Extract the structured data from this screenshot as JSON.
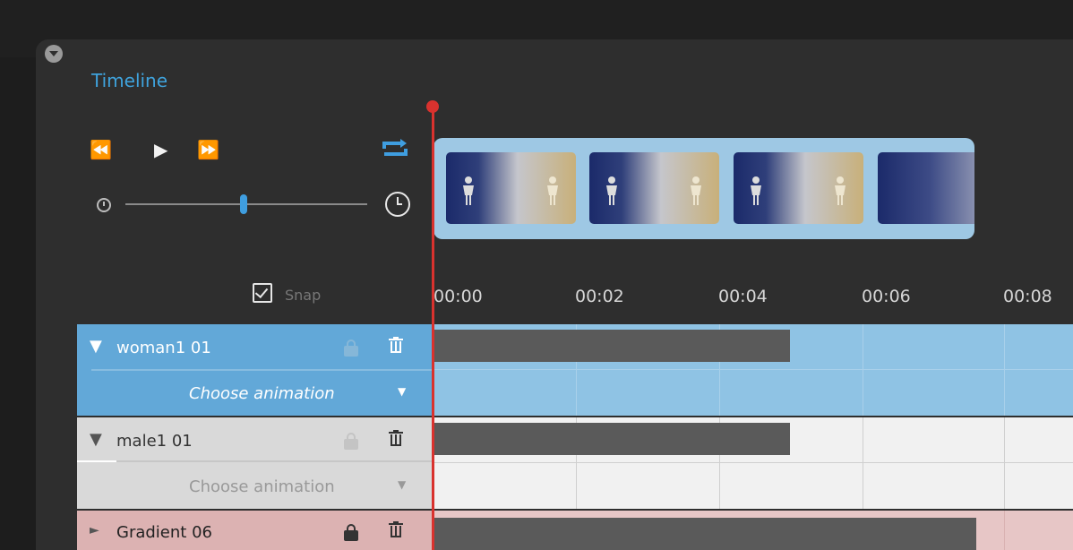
{
  "panel": {
    "title": "Timeline"
  },
  "transport": {
    "rewind_icon": "⏪",
    "play_icon": "▶",
    "ff_icon": "⏩"
  },
  "zoom_slider": {
    "value_percent": 49
  },
  "snap": {
    "label": "Snap",
    "checked": true
  },
  "ruler": {
    "labels": [
      "00:00",
      "00:02",
      "00:04",
      "00:06",
      "00:08"
    ]
  },
  "tracks": [
    {
      "name": "woman1 01",
      "subrow": "Choose animation",
      "state": "selected",
      "expander": "▼",
      "dropdown": "▼"
    },
    {
      "name": "male1 01",
      "subrow": "Choose animation",
      "state": "normal",
      "expander": "▼",
      "dropdown": "▼"
    },
    {
      "name": "Gradient 06",
      "state": "locked",
      "expander": "►"
    }
  ],
  "colors": {
    "accent": "#3fa3dd",
    "playhead": "#d9322e",
    "selected_row": "#6aaedb",
    "gradient_row": "#dcb2b2"
  }
}
